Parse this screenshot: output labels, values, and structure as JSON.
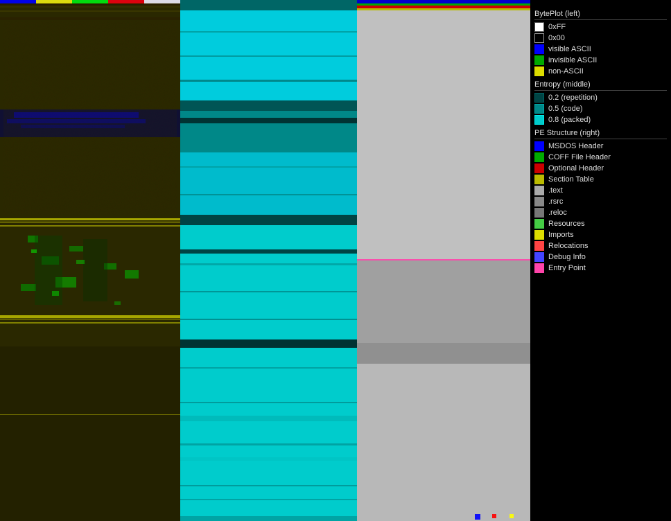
{
  "legend": {
    "title_byteplot": "BytePlot (left)",
    "title_entropy": "Entropy (middle)",
    "title_pe": "PE Structure (right)",
    "byteplot_items": [
      {
        "label": "0xFF",
        "color": "#ffffff",
        "border": "#999"
      },
      {
        "label": "0x00",
        "color": "#000000",
        "border": "#999"
      },
      {
        "label": "visible ASCII",
        "color": "#0000ff",
        "border": "#0000ff"
      },
      {
        "label": "invisible ASCII",
        "color": "#00aa00",
        "border": "#00aa00"
      },
      {
        "label": "non-ASCII",
        "color": "#dddd00",
        "border": "#dddd00"
      }
    ],
    "entropy_items": [
      {
        "label": "0.2 (repetition)",
        "color": "#004444",
        "border": "#006666"
      },
      {
        "label": "0.5 (code)",
        "color": "#008888",
        "border": "#00aaaa"
      },
      {
        "label": "0.8 (packed)",
        "color": "#00cccc",
        "border": "#00eeee"
      }
    ],
    "pe_items": [
      {
        "label": "MSDOS Header",
        "color": "#0000ff",
        "border": "#0000ff"
      },
      {
        "label": "COFF File Header",
        "color": "#00aa00",
        "border": "#00aa00"
      },
      {
        "label": "Optional Header",
        "color": "#cc0000",
        "border": "#cc0000"
      },
      {
        "label": "Section Table",
        "color": "#bbbb00",
        "border": "#bbbb00"
      },
      {
        "label": ".text",
        "color": "#aaaaaa",
        "border": "#aaaaaa"
      },
      {
        "label": ".rsrc",
        "color": "#888888",
        "border": "#888888"
      },
      {
        "label": ".reloc",
        "color": "#777777",
        "border": "#777777"
      },
      {
        "label": "Resources",
        "color": "#44cc44",
        "border": "#44cc44"
      },
      {
        "label": "Imports",
        "color": "#dddd00",
        "border": "#dddd00"
      },
      {
        "label": "Relocations",
        "color": "#ff4444",
        "border": "#ff4444"
      },
      {
        "label": "Debug Info",
        "color": "#4444ff",
        "border": "#4444ff"
      },
      {
        "label": "Entry Point",
        "color": "#ff44aa",
        "border": "#ff44aa"
      }
    ]
  },
  "visualization": {
    "byteplot_label": "BytePlot (left)",
    "entropy_label": "Entropy (middle)",
    "pe_label": "PE Structure (right)"
  }
}
